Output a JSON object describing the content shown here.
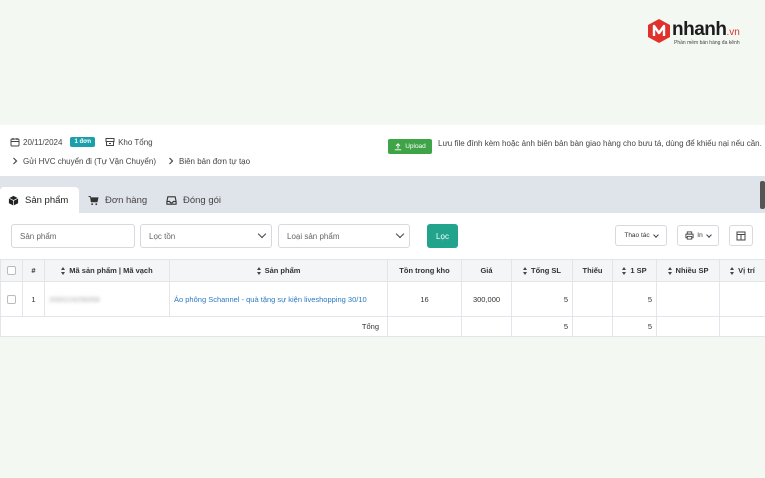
{
  "brand": {
    "name": "nhanh",
    "suffix": ".vn",
    "tagline": "Phần mềm bán hàng đa kênh",
    "colors": {
      "red": "#e0312a",
      "dark": "#1c1c1c"
    }
  },
  "info": {
    "date": "20/11/2024",
    "order_badge": "1 đơn",
    "warehouse": "Kho Tổng",
    "shipping": "Gửi HVC chuyển đi (Tự Vận Chuyển)",
    "report": "Biên bản đơn tự tạo"
  },
  "upload": {
    "button_label": "Upload",
    "description": "Lưu file đính kèm hoặc ảnh biên bản bàn giao hàng cho bưu tá, dùng để khiếu nại nếu cần."
  },
  "tabs": [
    {
      "label": "Sản phẩm",
      "icon": "box-icon",
      "active": true
    },
    {
      "label": "Đơn hàng",
      "icon": "cart-icon",
      "active": false
    },
    {
      "label": "Đóng gói",
      "icon": "inbox-icon",
      "active": false
    }
  ],
  "filters": {
    "product_placeholder": "Sản phẩm",
    "stock_filter": "Lọc tồn",
    "product_type": "Loại sản phẩm",
    "filter_button": "Lọc",
    "actions_button": "Thao tác",
    "print_button": "In"
  },
  "table": {
    "headers": [
      "#",
      "Mã sản phẩm | Mã vạch",
      "Sản phẩm",
      "Tồn trong kho",
      "Giá",
      "Tổng SL",
      "Thiếu",
      "1 SP",
      "Nhiều SP",
      "Vị trí"
    ],
    "rows": [
      {
        "index": "1",
        "code": "2000216258358",
        "product": "Áo phông Schannel - quà tặng sự kiện liveshopping 30/10",
        "stock": "16",
        "price": "300,000",
        "total_qty": "5",
        "missing": "",
        "one_sp": "5",
        "many_sp": "",
        "location": ""
      }
    ],
    "total": {
      "label": "Tổng",
      "total_qty": "5",
      "one_sp": "5"
    }
  },
  "colors": {
    "badge": "#1a9fab",
    "upload": "#3fa447",
    "filter_button": "#21a38c",
    "link": "#2a7ac2"
  }
}
